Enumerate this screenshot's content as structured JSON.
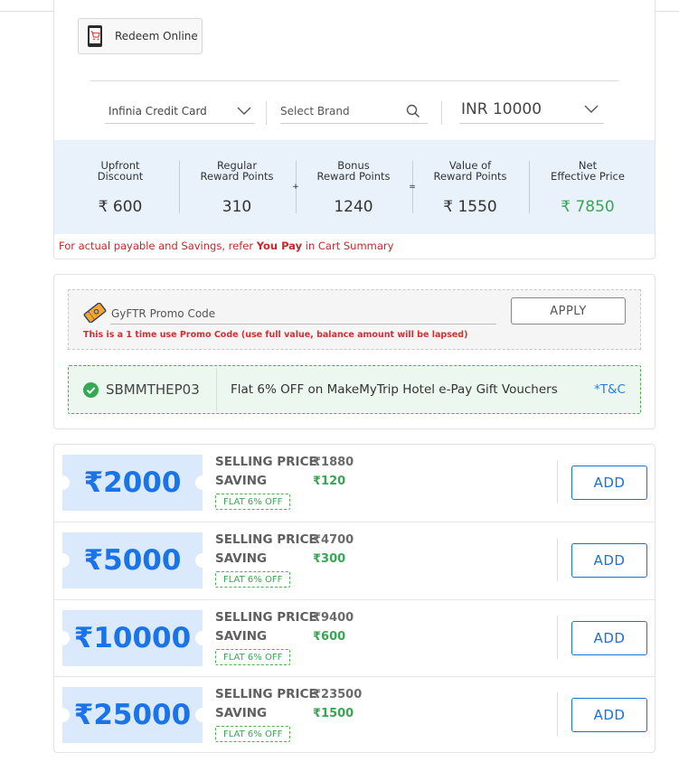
{
  "redeem": {
    "label": "Redeem Online",
    "icon": "shopping-cart-icon"
  },
  "filters": {
    "card": "Infinia Credit Card",
    "brand_placeholder": "Select Brand",
    "amount": "INR 10000"
  },
  "summary": {
    "items": [
      {
        "label_line1": "Upfront",
        "label_line2": "Discount",
        "value": "₹ 600"
      },
      {
        "label_line1": "Regular",
        "label_line2": "Reward Points",
        "value": "310"
      },
      {
        "label_line1": "Bonus",
        "label_line2": "Reward Points",
        "value": "1240"
      },
      {
        "label_line1": "Value of",
        "label_line2": "Reward Points",
        "value": "₹ 1550"
      },
      {
        "label_line1": "Net",
        "label_line2": "Effective Price",
        "value": "₹ 7850"
      }
    ],
    "op_plus": "+",
    "op_equals": "=",
    "net_color": "#3aa555"
  },
  "note": {
    "prefix": "For actual payable and Savings, refer ",
    "bold": "You Pay",
    "suffix": " in Cart Summary"
  },
  "promo": {
    "label": "GyFTR Promo Code",
    "warning": "This is a 1 time use Promo Code (use full value, balance amount will be lapsed)",
    "apply_label": "APPLY",
    "icon": "promo-ticket-icon"
  },
  "coupon": {
    "code": "SBMMTHEP03",
    "offer": "Flat 6% OFF on MakeMyTrip Hotel e-Pay Gift Vouchers",
    "tnc": "*T&C",
    "icon": "check-circle-icon"
  },
  "products": {
    "selling_label": "SELLING PRICE",
    "saving_label": "SAVING",
    "add_label": "ADD",
    "items": [
      {
        "denomination": "₹2000",
        "selling_price": "₹1880",
        "saving": "₹120",
        "badge": "FLAT 6% OFF"
      },
      {
        "denomination": "₹5000",
        "selling_price": "₹4700",
        "saving": "₹300",
        "badge": "FLAT 6% OFF"
      },
      {
        "denomination": "₹10000",
        "selling_price": "₹9400",
        "saving": "₹600",
        "badge": "FLAT 6% OFF"
      },
      {
        "denomination": "₹25000",
        "selling_price": "₹23500",
        "saving": "₹1500",
        "badge": "FLAT 6% OFF"
      }
    ]
  },
  "colors": {
    "accent_blue": "#1a73e8",
    "green": "#3aa555",
    "red": "#c62828",
    "summary_bg": "#e9f2fb",
    "voucher_bg": "#daeafc"
  }
}
